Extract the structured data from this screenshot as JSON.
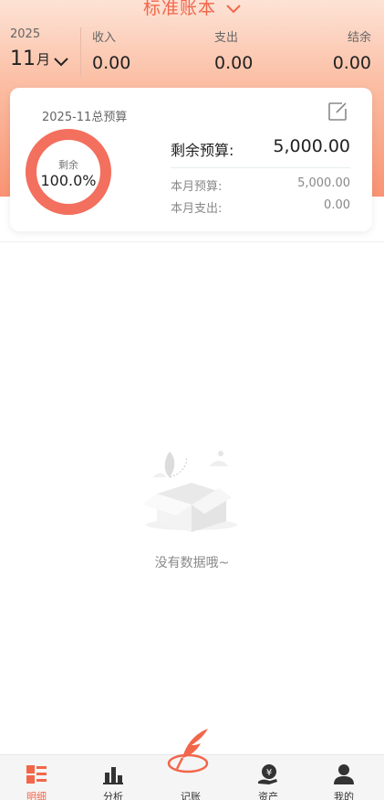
{
  "header": {
    "book_title": "标准账本"
  },
  "summary": {
    "year": "2025",
    "month": "11",
    "month_unit": "月",
    "income_label": "收入",
    "income_value": "0.00",
    "expense_label": "支出",
    "expense_value": "0.00",
    "balance_label": "结余",
    "balance_value": "0.00"
  },
  "budget": {
    "title": "2025-11总预算",
    "ring_label": "剩余",
    "ring_percent": "100.0%",
    "ring_fraction": 1.0,
    "remaining_label": "剩余预算:",
    "remaining_value": "5,000.00",
    "monthly_budget_label": "本月预算:",
    "monthly_budget_value": "5,000.00",
    "monthly_expense_label": "本月支出:",
    "monthly_expense_value": "0.00"
  },
  "empty": {
    "text": "没有数据哦~"
  },
  "tabs": [
    {
      "label": "明细",
      "icon": "list-icon",
      "active": true
    },
    {
      "label": "分析",
      "icon": "chart-icon",
      "active": false
    },
    {
      "label": "记账",
      "icon": "quill-icon",
      "active": false
    },
    {
      "label": "资产",
      "icon": "wallet-yen-icon",
      "active": false
    },
    {
      "label": "我的",
      "icon": "person-icon",
      "active": false
    }
  ],
  "colors": {
    "accent": "#f2664a",
    "ring": "#f36f5e"
  }
}
